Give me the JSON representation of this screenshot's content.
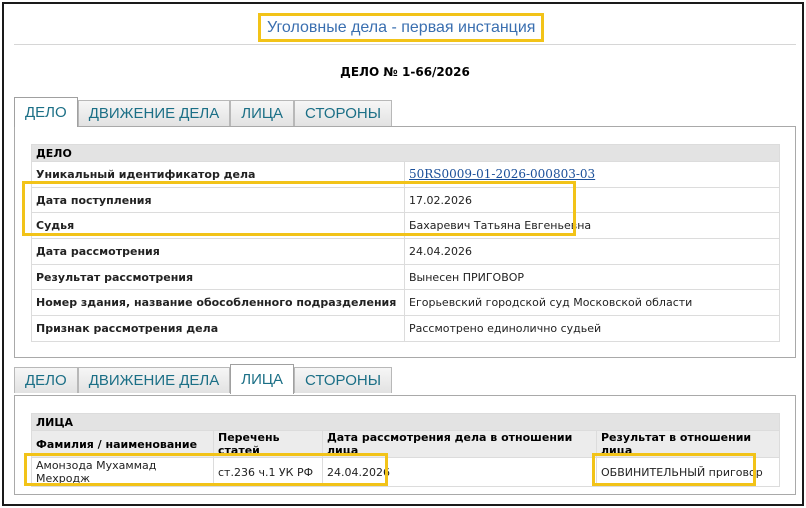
{
  "page_title": "Уголовные дела - первая инстанция",
  "case_number": "ДЕЛО № 1-66/2026",
  "tabs_top": [
    {
      "label": "ДЕЛО",
      "active": true
    },
    {
      "label": "ДВИЖЕНИЕ ДЕЛА",
      "active": false
    },
    {
      "label": "ЛИЦА",
      "active": false
    },
    {
      "label": "СТОРОНЫ",
      "active": false
    }
  ],
  "case_section": {
    "header": "ДЕЛО",
    "rows": [
      {
        "label": "Уникальный идентификатор дела",
        "value": "50RS0009-01-2026-000803-03",
        "link": true
      },
      {
        "label": "Дата поступления",
        "value": "17.02.2026"
      },
      {
        "label": "Судья",
        "value": "Бахаревич Татьяна Евгеньевна"
      },
      {
        "label": "Дата рассмотрения",
        "value": "24.04.2026"
      },
      {
        "label": "Результат рассмотрения",
        "value": "Вынесен ПРИГОВОР"
      },
      {
        "label": "Номер здания, название обособленного подразделения",
        "value": "Егорьевский городской суд Московской области"
      },
      {
        "label": "Признак рассмотрения дела",
        "value": "Рассмотрено единолично судьей"
      }
    ]
  },
  "tabs_bottom": [
    {
      "label": "ДЕЛО",
      "active": false
    },
    {
      "label": "ДВИЖЕНИЕ ДЕЛА",
      "active": false
    },
    {
      "label": "ЛИЦА",
      "active": true
    },
    {
      "label": "СТОРОНЫ",
      "active": false
    }
  ],
  "persons_section": {
    "header": "ЛИЦА",
    "columns": [
      "Фамилия / наименование",
      "Перечень статей",
      "Дата рассмотрения дела в отношении лица",
      "Результат в отношении лица"
    ],
    "rows": [
      [
        "Амонзода Мухаммад Мехродж",
        "ст.236 ч.1 УК РФ",
        "24.04.2026",
        "ОБВИНИТЕЛЬНЫЙ приговор"
      ]
    ]
  },
  "colors": {
    "highlight": "#f2c318",
    "tab_text": "#1b6f86",
    "title_text": "#3a6fb0",
    "link": "#1a4f99"
  }
}
